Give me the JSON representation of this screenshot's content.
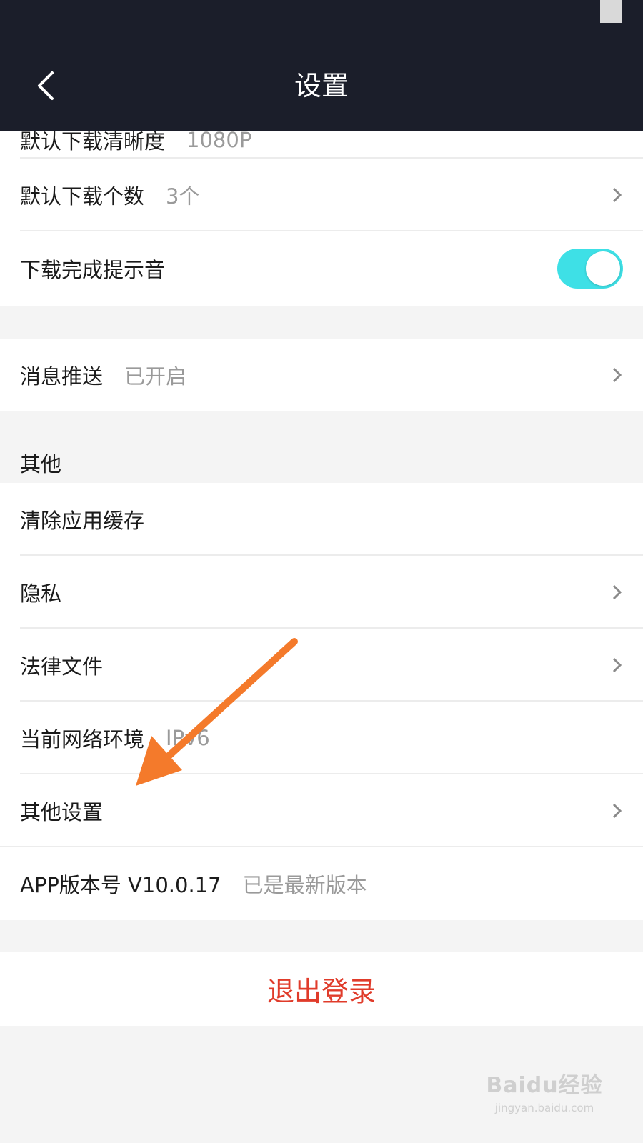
{
  "header": {
    "title": "设置"
  },
  "rows": {
    "partial_top": {
      "label": "默认下载清晰度",
      "value": "1080P"
    },
    "download_count": {
      "label": "默认下载个数",
      "value": "3个"
    },
    "download_sound": {
      "label": "下载完成提示音",
      "toggle_on": true
    },
    "push": {
      "label": "消息推送",
      "value": "已开启"
    }
  },
  "other_section": {
    "heading": "其他",
    "items": [
      {
        "label": "清除应用缓存",
        "value": ""
      },
      {
        "label": "隐私",
        "value": ""
      },
      {
        "label": "法律文件",
        "value": ""
      },
      {
        "label": "当前网络环境",
        "value": "IPv6"
      },
      {
        "label": "其他设置",
        "value": ""
      }
    ]
  },
  "version": {
    "label": "APP版本号 V10.0.17",
    "value": "已是最新版本"
  },
  "logout_label": "退出登录",
  "colors": {
    "header_bg": "#1b1e2a",
    "toggle": "#3ee0e6",
    "logout": "#e03b2a",
    "annotation_arrow": "#f47a2b"
  },
  "watermark": {
    "main": "Baidu经验",
    "sub": "jingyan.baidu.com"
  }
}
